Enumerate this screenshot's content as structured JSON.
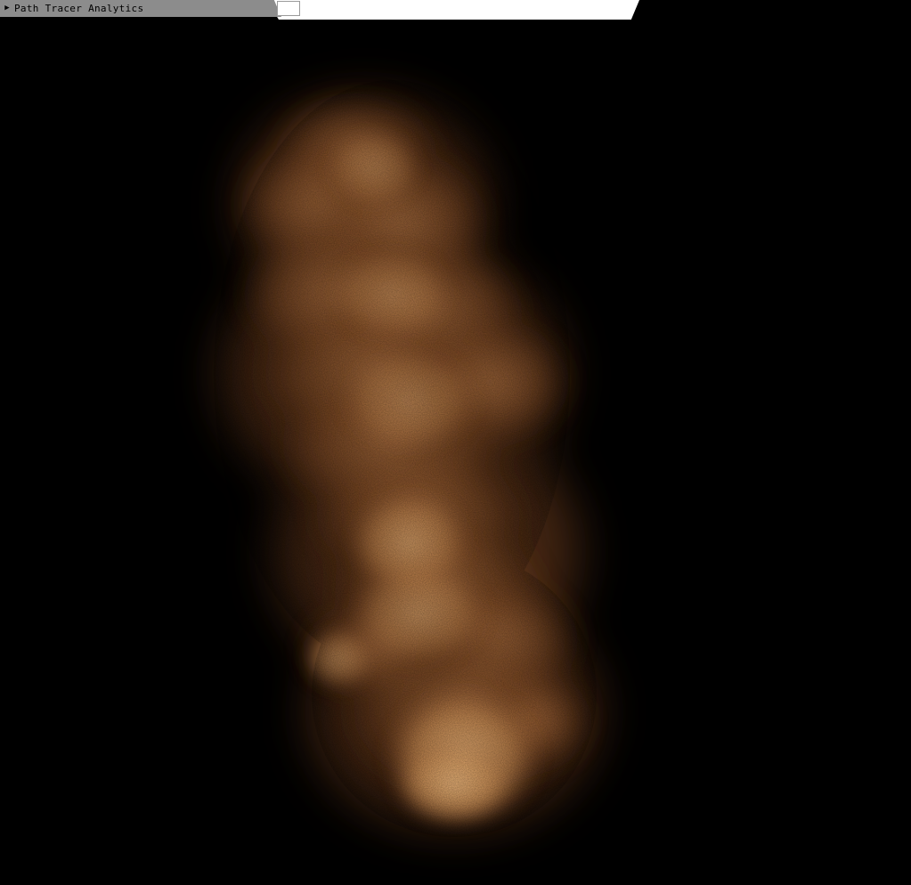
{
  "window": {
    "title": "Path Tracer Analytics",
    "collapsed": true,
    "arrow_icon": "triangle-right-icon"
  },
  "colors": {
    "background": "#000000",
    "title_bar": "#8c8c8c",
    "smoke_core": "#f0b070",
    "smoke_mid": "#c07a40",
    "smoke_edge": "#6a3a1a"
  },
  "render": {
    "subject": "volumetric smoke plume"
  }
}
